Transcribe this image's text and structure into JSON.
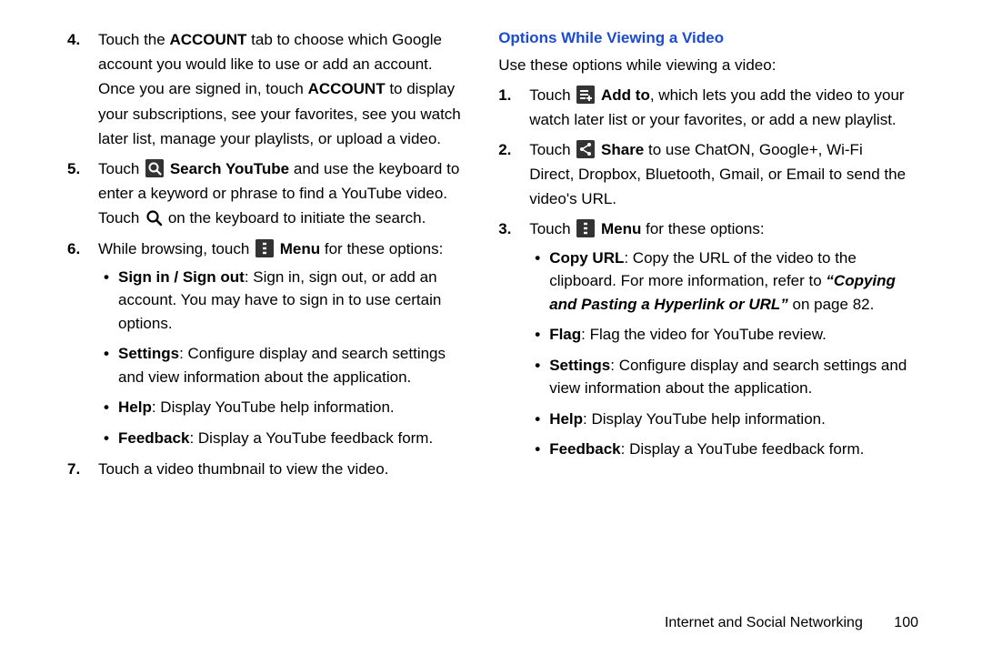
{
  "left": {
    "items": [
      {
        "num": "4.",
        "runs": [
          {
            "t": "Touch the "
          },
          {
            "t": "ACCOUNT",
            "b": true
          },
          {
            "t": " tab to choose which Google account you would like to use or add an account. Once you are signed in, touch "
          },
          {
            "t": "ACCOUNT",
            "b": true
          },
          {
            "t": " to display your subscriptions, see your favorites, see you watch later list, manage your playlists, or upload a video."
          }
        ]
      },
      {
        "num": "5.",
        "runs": [
          {
            "t": "Touch "
          },
          {
            "icon": "search-box-icon"
          },
          {
            "t": " "
          },
          {
            "t": "Search YouTube",
            "b": true
          },
          {
            "t": " and use the keyboard to enter a keyword or phrase to find a YouTube video. Touch "
          },
          {
            "icon": "search-icon",
            "inline": true
          },
          {
            "t": " on the keyboard to initiate the search."
          }
        ]
      },
      {
        "num": "6.",
        "runs": [
          {
            "t": "While browsing, touch "
          },
          {
            "icon": "menu-icon"
          },
          {
            "t": " "
          },
          {
            "t": "Menu",
            "b": true
          },
          {
            "t": " for these options:"
          }
        ],
        "bullets": [
          {
            "runs": [
              {
                "t": "Sign in / Sign out",
                "b": true
              },
              {
                "t": ": Sign in, sign out, or add an account. You may have to sign in to use certain options."
              }
            ]
          },
          {
            "runs": [
              {
                "t": "Settings",
                "b": true
              },
              {
                "t": ": Configure display and search settings and view information about the application."
              }
            ]
          },
          {
            "runs": [
              {
                "t": "Help",
                "b": true
              },
              {
                "t": ": Display YouTube help information."
              }
            ]
          },
          {
            "runs": [
              {
                "t": "Feedback",
                "b": true
              },
              {
                "t": ": Display a YouTube feedback form."
              }
            ]
          }
        ]
      },
      {
        "num": "7.",
        "runs": [
          {
            "t": "Touch a video thumbnail to view the video."
          }
        ]
      }
    ]
  },
  "right": {
    "heading": "Options While Viewing a Video",
    "intro": "Use these options while viewing a video:",
    "items": [
      {
        "num": "1.",
        "runs": [
          {
            "t": "Touch "
          },
          {
            "icon": "add-to-icon"
          },
          {
            "t": " "
          },
          {
            "t": "Add to",
            "b": true
          },
          {
            "t": ", which lets you add the video to your watch later list or your favorites, or add a new playlist."
          }
        ]
      },
      {
        "num": "2.",
        "runs": [
          {
            "t": "Touch "
          },
          {
            "icon": "share-icon"
          },
          {
            "t": " "
          },
          {
            "t": "Share",
            "b": true
          },
          {
            "t": " to use ChatON, Google+, Wi-Fi Direct, Dropbox, Bluetooth, Gmail, or Email to send the video's URL."
          }
        ]
      },
      {
        "num": "3.",
        "runs": [
          {
            "t": "Touch "
          },
          {
            "icon": "menu-icon"
          },
          {
            "t": " "
          },
          {
            "t": "Menu",
            "b": true
          },
          {
            "t": " for these options:"
          }
        ],
        "bullets": [
          {
            "runs": [
              {
                "t": "Copy URL",
                "b": true
              },
              {
                "t": ": Copy the URL of the video to the clipboard. For more information, refer to "
              },
              {
                "t": "“Copying and Pasting a Hyperlink or URL”",
                "i": true,
                "b": true
              },
              {
                "t": " on page 82."
              }
            ]
          },
          {
            "runs": [
              {
                "t": "Flag",
                "b": true
              },
              {
                "t": ": Flag the video for YouTube review."
              }
            ]
          },
          {
            "runs": [
              {
                "t": "Settings",
                "b": true
              },
              {
                "t": ": Configure display and search settings and view information about the application."
              }
            ]
          },
          {
            "runs": [
              {
                "t": "Help",
                "b": true
              },
              {
                "t": ": Display YouTube help information."
              }
            ]
          },
          {
            "runs": [
              {
                "t": "Feedback",
                "b": true
              },
              {
                "t": ": Display a YouTube feedback form."
              }
            ]
          }
        ]
      }
    ]
  },
  "footer": {
    "section": "Internet and Social Networking",
    "page": "100"
  },
  "icons": {
    "search-box-icon": "search-box",
    "search-icon": "search",
    "menu-icon": "menu",
    "add-to-icon": "addto",
    "share-icon": "share"
  }
}
